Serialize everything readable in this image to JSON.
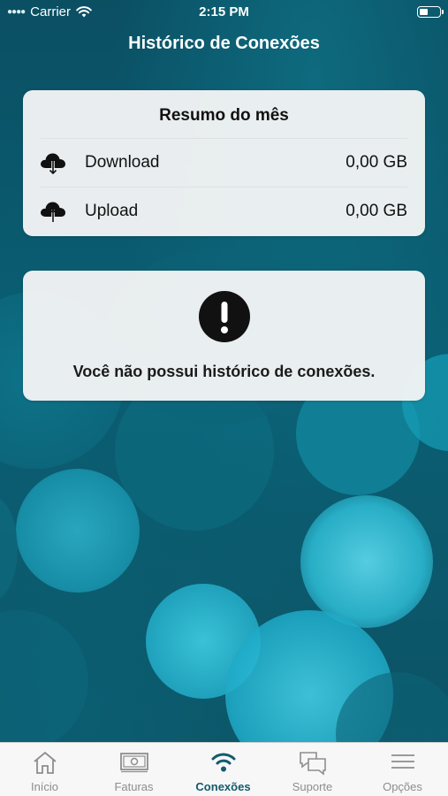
{
  "status_bar": {
    "carrier": "Carrier",
    "time": "2:15 PM"
  },
  "nav": {
    "title": "Histórico de Conexões"
  },
  "summary": {
    "title": "Resumo do mês",
    "rows": [
      {
        "icon": "cloud-download-icon",
        "label": "Download",
        "value": "0,00 GB"
      },
      {
        "icon": "cloud-upload-icon",
        "label": "Upload",
        "value": "0,00 GB"
      }
    ]
  },
  "empty_state": {
    "icon": "exclamation-circle-icon",
    "message": "Você não possui histórico de conexões."
  },
  "tabbar": {
    "active_color": "#135a6d",
    "tabs": [
      {
        "label": "Início",
        "icon": "home-icon",
        "active": false
      },
      {
        "label": "Faturas",
        "icon": "bill-icon",
        "active": false
      },
      {
        "label": "Conexões",
        "icon": "wifi-icon",
        "active": true
      },
      {
        "label": "Suporte",
        "icon": "chat-bubbles-icon",
        "active": false
      },
      {
        "label": "Opções",
        "icon": "menu-icon",
        "active": false
      }
    ]
  }
}
